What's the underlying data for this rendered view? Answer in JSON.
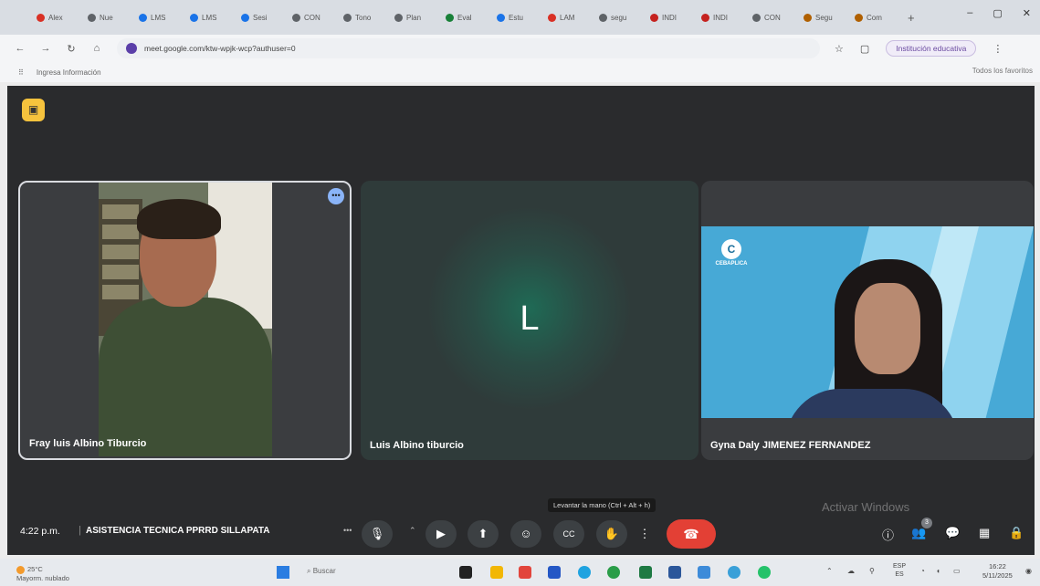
{
  "browser": {
    "tabs": [
      {
        "label": "Alex",
        "color": "#d93025"
      },
      {
        "label": "Nue",
        "color": "#5f6368"
      },
      {
        "label": "LMS",
        "color": "#1a73e8"
      },
      {
        "label": "LMS",
        "color": "#1a73e8"
      },
      {
        "label": "Sesi",
        "color": "#1a73e8"
      },
      {
        "label": "CON",
        "color": "#5f6368"
      },
      {
        "label": "Tono",
        "color": "#5f6368"
      },
      {
        "label": "Plan",
        "color": "#5f6368"
      },
      {
        "label": "Eval",
        "color": "#188038"
      },
      {
        "label": "Estu",
        "color": "#1a73e8"
      },
      {
        "label": "LAM",
        "color": "#d93025"
      },
      {
        "label": "segu",
        "color": "#5f6368"
      },
      {
        "label": "INDI",
        "color": "#c5221f"
      },
      {
        "label": "INDI",
        "color": "#c5221f"
      },
      {
        "label": "CON",
        "color": "#5f6368"
      },
      {
        "label": "Segu",
        "color": "#b06000"
      },
      {
        "label": "Com",
        "color": "#b06000"
      }
    ],
    "new_tab": "+",
    "window_controls": [
      "–",
      "▢",
      "✕"
    ],
    "url": "meet.google.com/ktw-wpjk-wcp?authuser=0",
    "profile": "Institución educativa",
    "bookmark": "Ingresa Información",
    "bookmarks_right": "Todos los favoritos"
  },
  "meet": {
    "participants": [
      {
        "name": "Fray luis Albino Tiburcio",
        "video": true
      },
      {
        "name": "Luis Albino tiburcio",
        "avatar_letter": "L",
        "video": false
      },
      {
        "name": "Gyna Daly JIMENEZ FERNANDEZ",
        "video": true,
        "background_logo": "CEBAPLICA"
      }
    ],
    "time": "4:22 p.m.",
    "meeting_title": "ASISTENCIA TECNICA PPRRD SILLAPATA",
    "tooltip": "Levantar la mano (Ctrl + Alt + h)",
    "watermark": "Activar Windows",
    "people_count": "3",
    "icons": {
      "mic": "🎙",
      "camera": "▶",
      "present": "⬆",
      "emoji": "☺",
      "captions": "CC",
      "hand": "✋",
      "more": "⋮",
      "hangup": "☎",
      "info": "ⓘ",
      "people": "👥",
      "chat": "💬",
      "activities": "▦",
      "lock": "🔒"
    }
  },
  "taskbar": {
    "weather_temp": "25°C",
    "weather_text": "Mayorm. nublado",
    "search": "Buscar",
    "lang": "ESP",
    "lang2": "ES",
    "time": "16:22",
    "date": "5/11/2025"
  },
  "colors": {
    "meet_bg": "#2a2b2d",
    "hangup": "#e34035",
    "accent_yellow": "#f6c33d"
  }
}
